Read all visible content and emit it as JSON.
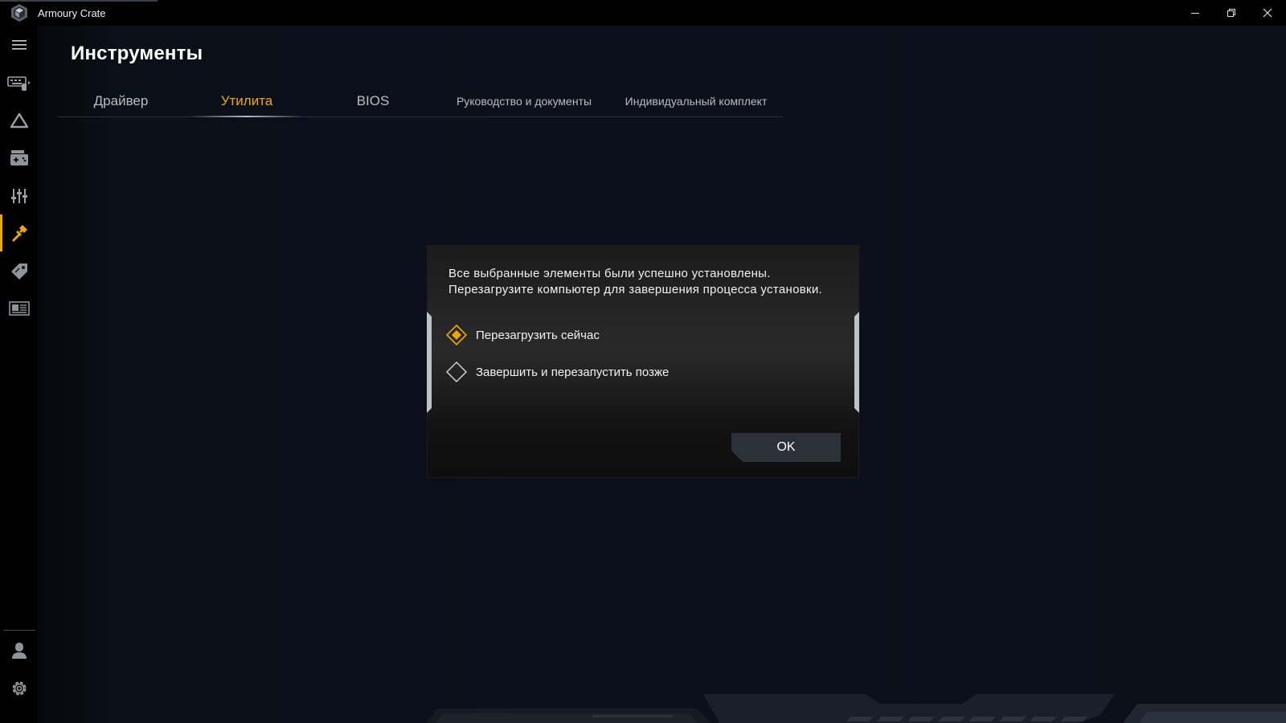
{
  "window": {
    "title": "Armoury Crate",
    "controls": [
      "minimize-icon",
      "restore-icon",
      "close-icon"
    ]
  },
  "sidebar": {
    "items": [
      {
        "icon": "menu-icon",
        "active": false
      },
      {
        "icon": "device-icon",
        "active": false
      },
      {
        "icon": "aura-triangle-icon",
        "active": false
      },
      {
        "icon": "game-library-icon",
        "active": false
      },
      {
        "icon": "settings-sliders-icon",
        "active": false
      },
      {
        "icon": "tools-wrench-icon",
        "active": true
      },
      {
        "icon": "deals-tag-icon",
        "active": false
      },
      {
        "icon": "news-icon",
        "active": false
      },
      {
        "icon": "user-icon",
        "active": false
      },
      {
        "icon": "gear-icon",
        "active": false
      }
    ],
    "accent_color": "#f0a800"
  },
  "main": {
    "title": "Инструменты",
    "tabs": [
      {
        "label": "Драйвер",
        "active": false
      },
      {
        "label": "Утилита",
        "active": true
      },
      {
        "label": "BIOS",
        "active": false
      },
      {
        "label": "Руководство и документы",
        "active": false
      },
      {
        "label": "Индивидуальный комплект",
        "active": false
      }
    ]
  },
  "dialog": {
    "message_line1": "Все выбранные элементы были успешно установлены.",
    "message_line2": "Перезагрузите компьютер для завершения процесса установки.",
    "options": [
      {
        "label": "Перезагрузить сейчас",
        "selected": true
      },
      {
        "label": "Завершить и перезапустить позже",
        "selected": false
      }
    ],
    "ok_label": "OK"
  },
  "colors": {
    "accent": "#f0a800",
    "background": "#0b111a",
    "dialog_button": "#2c3038"
  }
}
